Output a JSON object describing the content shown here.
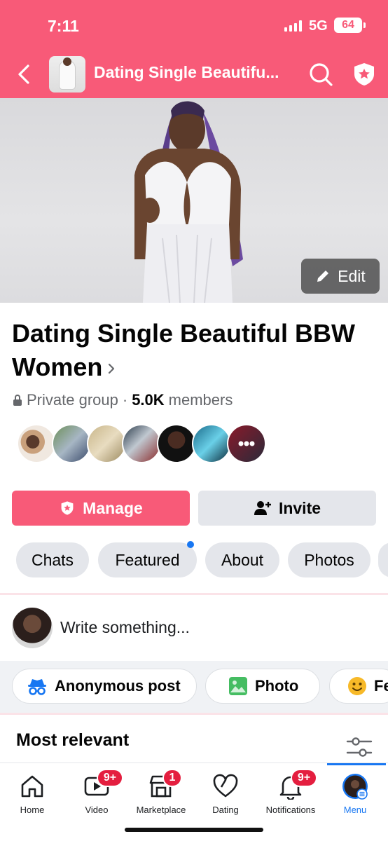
{
  "status_bar": {
    "time": "7:11",
    "network": "5G",
    "battery": "64"
  },
  "header": {
    "title": "Dating Single Beautifu..."
  },
  "cover": {
    "edit_label": "Edit"
  },
  "group": {
    "name": "Dating Single Beautiful BBW Women",
    "privacy": "Private group",
    "separator": "·",
    "member_count": "5.0K",
    "members_label": "members"
  },
  "actions": {
    "manage_label": "Manage",
    "invite_label": "Invite"
  },
  "tabs": [
    {
      "label": "Chats"
    },
    {
      "label": "Featured"
    },
    {
      "label": "About"
    },
    {
      "label": "Photos"
    }
  ],
  "composer": {
    "placeholder": "Write something..."
  },
  "post_chips": [
    {
      "label": "Anonymous post",
      "icon": "incognito-icon"
    },
    {
      "label": "Photo",
      "icon": "photo-icon"
    },
    {
      "label": "Fe",
      "icon": "feeling-icon"
    }
  ],
  "feed": {
    "sort_label": "Most relevant"
  },
  "bottom_nav": [
    {
      "label": "Home",
      "icon": "home-icon"
    },
    {
      "label": "Video",
      "icon": "video-icon",
      "badge": "9+"
    },
    {
      "label": "Marketplace",
      "icon": "marketplace-icon",
      "badge": "1"
    },
    {
      "label": "Dating",
      "icon": "heart-icon"
    },
    {
      "label": "Notifications",
      "icon": "bell-icon",
      "badge": "9+"
    },
    {
      "label": "Menu",
      "icon": "menu-avatar-icon",
      "active": true
    }
  ],
  "colors": {
    "brand": "#f85a78",
    "active": "#1877f2",
    "badge": "#e41e3f"
  }
}
